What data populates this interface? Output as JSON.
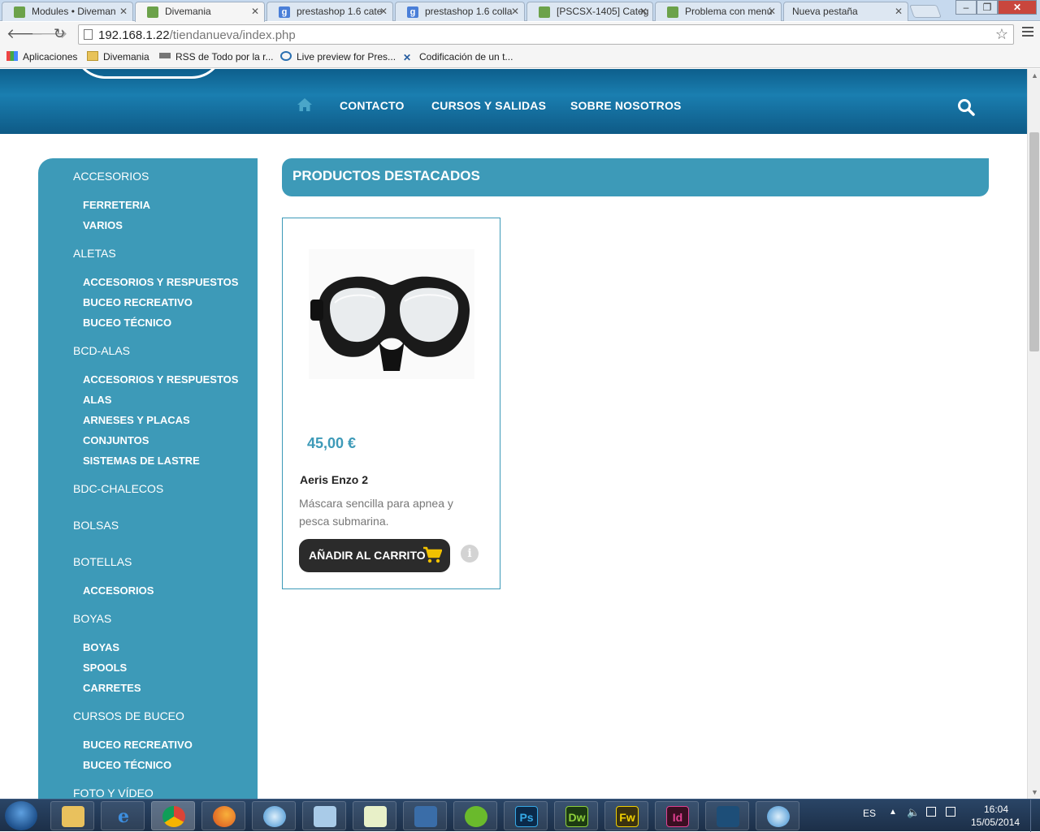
{
  "browser": {
    "tabs": [
      {
        "label": "Modules • Diveman",
        "favicon": "prestashop-icon"
      },
      {
        "label": "Divemania",
        "favicon": "prestashop-icon",
        "active": true
      },
      {
        "label": "prestashop 1.6 cate",
        "favicon": "google-icon"
      },
      {
        "label": "prestashop 1.6 colla",
        "favicon": "google-icon"
      },
      {
        "label": "[PSCSX-1405] Categ",
        "favicon": "prestashop-icon"
      },
      {
        "label": "Problema con menú",
        "favicon": "prestashop-icon"
      },
      {
        "label": "Nueva pestaña",
        "favicon": ""
      }
    ],
    "url_host": "192.168.1.22",
    "url_path": "/tiendanueva/index.php",
    "bookmarks": [
      {
        "label": "Aplicaciones",
        "icon": "apps-grid-icon"
      },
      {
        "label": "Divemania",
        "icon": "folder-icon"
      },
      {
        "label": "RSS de Todo por la r...",
        "icon": "seo-icon"
      },
      {
        "label": "Live preview for Pres...",
        "icon": "octopus-icon"
      },
      {
        "label": "Codificación de un t...",
        "icon": "tools-icon"
      }
    ]
  },
  "site": {
    "nav": [
      "CONTACTO",
      "CURSOS Y SALIDAS",
      "SOBRE NOSOTROS"
    ],
    "sidebar": [
      {
        "label": "ACCESORIOS",
        "level": 1
      },
      {
        "label": "FERRETERIA",
        "level": 2
      },
      {
        "label": "VARIOS",
        "level": 2
      },
      {
        "label": "ALETAS",
        "level": 1
      },
      {
        "label": "ACCESORIOS Y RESPUESTOS",
        "level": 2
      },
      {
        "label": "BUCEO RECREATIVO",
        "level": 2
      },
      {
        "label": "BUCEO TÉCNICO",
        "level": 2
      },
      {
        "label": "BCD-ALAS",
        "level": 1
      },
      {
        "label": "ACCESORIOS Y RESPUESTOS",
        "level": 2
      },
      {
        "label": "ALAS",
        "level": 2
      },
      {
        "label": "ARNESES Y PLACAS",
        "level": 2
      },
      {
        "label": "CONJUNTOS",
        "level": 2
      },
      {
        "label": "SISTEMAS DE LASTRE",
        "level": 2
      },
      {
        "label": "BDC-CHALECOS",
        "level": 1
      },
      {
        "label": "BOLSAS",
        "level": 1
      },
      {
        "label": "BOTELLAS",
        "level": 1
      },
      {
        "label": "ACCESORIOS",
        "level": 2
      },
      {
        "label": "BOYAS",
        "level": 1
      },
      {
        "label": "BOYAS",
        "level": 2
      },
      {
        "label": "SPOOLS",
        "level": 2
      },
      {
        "label": "CARRETES",
        "level": 2
      },
      {
        "label": "CURSOS DE BUCEO",
        "level": 1
      },
      {
        "label": "BUCEO RECREATIVO",
        "level": 2
      },
      {
        "label": "BUCEO TÉCNICO",
        "level": 2
      },
      {
        "label": "FOTO Y VÍDEO",
        "level": 1
      }
    ],
    "section_title": "PRODUCTOS DESTACADOS",
    "product": {
      "price": "45,00 €",
      "name": "Aeris Enzo 2",
      "description": "Máscara sencilla para apnea y pesca submarina.",
      "add_to_cart": "AÑADIR AL CARRITO"
    },
    "colors": {
      "accent": "#3d9ab8",
      "header": "#0d5e8c",
      "button": "#2b2b2b",
      "cart_icon": "#f2c200"
    }
  },
  "taskbar": {
    "apps": [
      "explorer-icon",
      "ie-icon",
      "chrome-icon",
      "firefox-icon",
      "safari-icon",
      "virtualbox-cube-icon",
      "notepad-icon",
      "virtualbox-icon",
      "spotify-icon",
      "photoshop-icon",
      "dreamweaver-icon",
      "fireworks-icon",
      "indesign-icon",
      "mysql-workbench-icon",
      "safari-icon"
    ],
    "app_labels": {
      "ps": "Ps",
      "dw": "Dw",
      "fw": "Fw",
      "id": "Id"
    },
    "language": "ES",
    "time": "16:04",
    "date": "15/05/2014"
  }
}
